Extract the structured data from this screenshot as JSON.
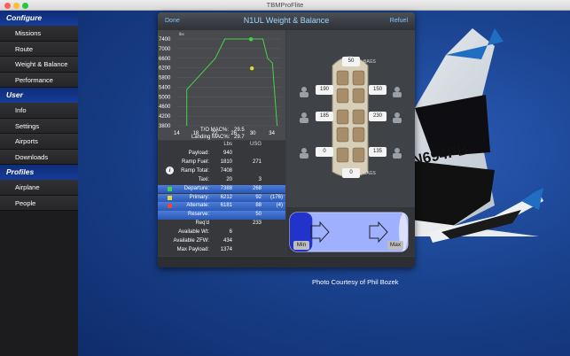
{
  "window": {
    "title": "TBMProFlite"
  },
  "sidebar": {
    "sections": [
      {
        "title": "Configure",
        "items": [
          {
            "label": "Missions"
          },
          {
            "label": "Route"
          },
          {
            "label": "Weight & Balance"
          },
          {
            "label": "Performance"
          }
        ]
      },
      {
        "title": "User",
        "items": [
          {
            "label": "Info"
          },
          {
            "label": "Settings"
          },
          {
            "label": "Airports"
          },
          {
            "label": "Downloads"
          }
        ]
      },
      {
        "title": "Profiles",
        "items": [
          {
            "label": "Airplane"
          },
          {
            "label": "People"
          }
        ]
      }
    ]
  },
  "panel": {
    "done_label": "Done",
    "title": "N1UL Weight & Balance",
    "refuel_label": "Refuel"
  },
  "chart_data": {
    "type": "scatter",
    "ylabel": "lbs",
    "y_ticks": [
      "7400",
      "7000",
      "6600",
      "6200",
      "5800",
      "5400",
      "5000",
      "4600",
      "4200",
      "3800"
    ],
    "x_ticks": [
      "14",
      "18",
      "22",
      "26",
      "30",
      "34"
    ],
    "ylim": [
      3800,
      7400
    ],
    "xlim": [
      14,
      36
    ],
    "envelope": [
      [
        16,
        3800
      ],
      [
        16,
        5300
      ],
      [
        22,
        6600
      ],
      [
        23,
        7000
      ],
      [
        24,
        7400
      ],
      [
        32,
        7400
      ],
      [
        33,
        6600
      ],
      [
        34,
        6400
      ],
      [
        35,
        3800
      ]
    ],
    "series": [
      {
        "marker_color": "#46d34a",
        "points": [
          [
            29.5,
            7388
          ]
        ]
      },
      {
        "marker_color": "#e5d83c",
        "points": [
          [
            29.7,
            6181
          ]
        ]
      }
    ],
    "annotations": [
      {
        "label": "T/O  MAC%:",
        "value": "29.5"
      },
      {
        "label": "Landing  MAC%:",
        "value": "29.7"
      }
    ]
  },
  "seating": {
    "top_bags": "50",
    "top_bags_label": "BAGS",
    "rows": [
      {
        "left": "190",
        "right": "150"
      },
      {
        "left": "185",
        "right": "230"
      },
      {
        "left": "0",
        "right": "135"
      }
    ],
    "aft_bags": "0",
    "aft_bags_label": "BAGS"
  },
  "table": {
    "headers": [
      "Lbs",
      "USG"
    ],
    "rows": [
      {
        "label": "Payload:",
        "v1": "940",
        "v2": "",
        "v3": ""
      },
      {
        "label": "Ramp Fuel:",
        "v1": "1810",
        "v2": "271",
        "v3": ""
      },
      {
        "label": "Ramp Total:",
        "v1": "7408",
        "v2": "",
        "v3": ""
      },
      {
        "label": "Taxi:",
        "v1": "20",
        "v2": "3",
        "v3": ""
      },
      {
        "label": "Departure:",
        "v1": "7388",
        "v2": "268",
        "v3": "",
        "dot": "#46d34a",
        "blue": true
      },
      {
        "label": "Primary:",
        "v1": "6212",
        "v2": "92",
        "v3": "(176)",
        "dot": "#e5d83c",
        "blue": true
      },
      {
        "label": "Alternate:",
        "v1": "6181",
        "v2": "88",
        "v3": "(4)",
        "dot": "#e24a3a",
        "blue": true
      },
      {
        "label": "Reserve:",
        "v1": "",
        "v2": "50",
        "v3": "",
        "blue": true
      },
      {
        "label": "Req'd",
        "v1": "",
        "v2": "233",
        "v3": ""
      },
      {
        "label": "Available Wt:",
        "v1": "6",
        "v2": "",
        "v3": ""
      },
      {
        "label": "Available ZFW:",
        "v1": "434",
        "v2": "",
        "v3": ""
      },
      {
        "label": "Max Payload:",
        "v1": "1374",
        "v2": "",
        "v3": ""
      }
    ]
  },
  "fuel": {
    "min_label": "Min",
    "max_label": "Max",
    "level": 0.19
  },
  "photo": {
    "credit": "Photo Courtesy of Phil Bozek",
    "tail_number": "N694PB"
  }
}
